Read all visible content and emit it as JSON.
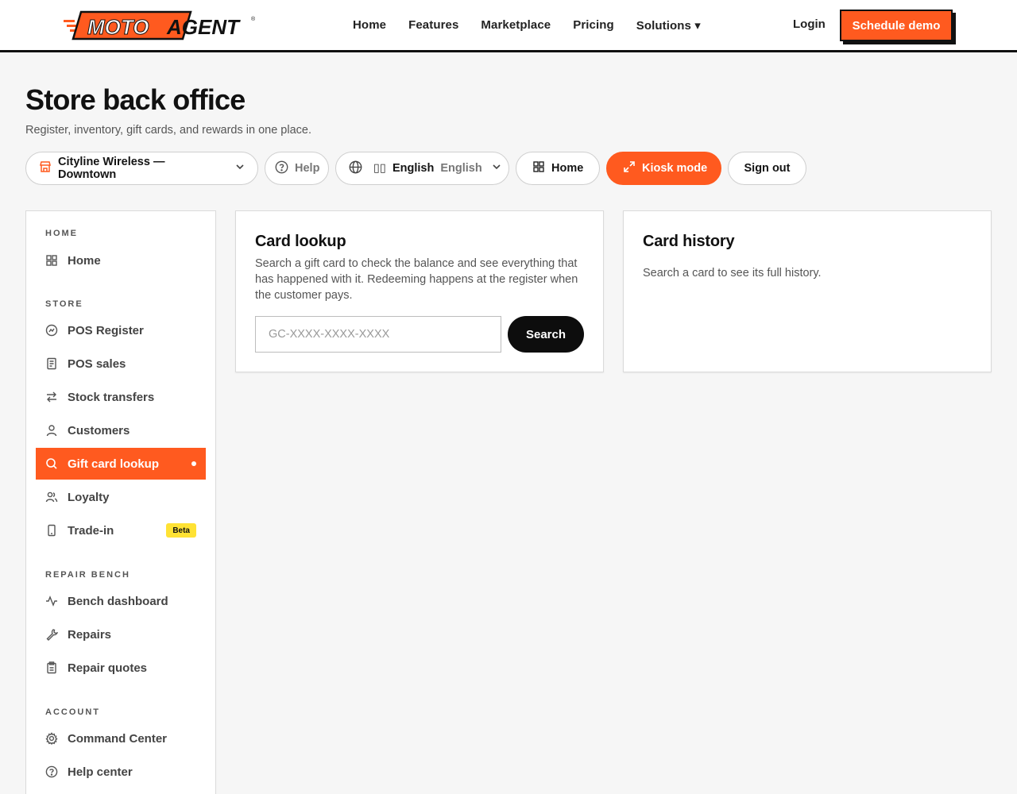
{
  "brand": {
    "logo_word_1": "MOTO",
    "logo_word_2": "AGENT",
    "accent": "#ff5a1f",
    "dark": "#111111",
    "highlight": "#ffe234"
  },
  "topnav": {
    "links": [
      "Home",
      "Features",
      "Marketplace",
      "Pricing",
      "Solutions ▾"
    ],
    "login": "Login",
    "cta": "Schedule demo"
  },
  "header": {
    "title": "Store back office",
    "subtitle": "Register, inventory, gift cards, and rewards in one place."
  },
  "toolbar": {
    "store": "Cityline Wireless — Downtown",
    "help": "Help",
    "lang_flag": "▯▯",
    "lang_current": "English",
    "lang_native": "English",
    "home": "Home",
    "kiosk": "Kiosk mode",
    "signout": "Sign out"
  },
  "sidebar": {
    "sections": [
      {
        "label": "HOME",
        "items": [
          {
            "label": "Home",
            "icon": "grid-icon"
          }
        ]
      },
      {
        "label": "STORE",
        "items": [
          {
            "label": "POS Register",
            "icon": "register-icon"
          },
          {
            "label": "POS sales",
            "icon": "receipt-icon"
          },
          {
            "label": "Stock transfers",
            "icon": "transfer-icon"
          },
          {
            "label": "Customers",
            "icon": "user-icon"
          },
          {
            "label": "Gift card lookup",
            "icon": "search-icon",
            "active": true
          },
          {
            "label": "Loyalty",
            "icon": "users-icon"
          },
          {
            "label": "Trade-in",
            "icon": "phone-icon",
            "badge": "Beta"
          }
        ]
      },
      {
        "label": "REPAIR BENCH",
        "items": [
          {
            "label": "Bench dashboard",
            "icon": "activity-icon"
          },
          {
            "label": "Repairs",
            "icon": "wrench-icon"
          },
          {
            "label": "Repair quotes",
            "icon": "clipboard-icon"
          }
        ]
      },
      {
        "label": "ACCOUNT",
        "items": [
          {
            "label": "Command Center",
            "icon": "gear-icon"
          },
          {
            "label": "Help center",
            "icon": "help-icon"
          }
        ]
      }
    ]
  },
  "lookup": {
    "title": "Card lookup",
    "description": "Search a gift card to check the balance and see everything that has happened with it. Redeeming happens at the register when the customer pays.",
    "placeholder": "GC-XXXX-XXXX-XXXX",
    "button": "Search"
  },
  "history": {
    "title": "Card history",
    "empty": "Search a card to see its full history."
  }
}
